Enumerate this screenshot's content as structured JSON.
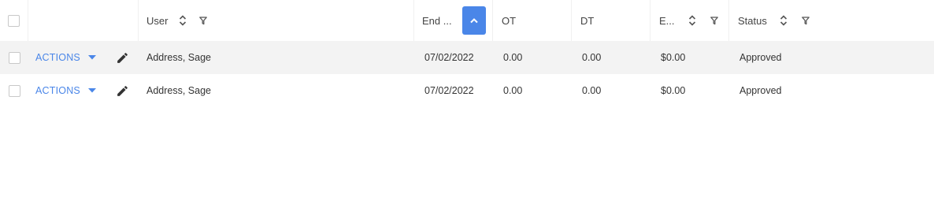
{
  "colors": {
    "accent": "#4a86e8",
    "row_shade": "#f3f3f3",
    "text": "#333333"
  },
  "header": {
    "user_label": "User",
    "end_label": "End ...",
    "ot_label": "OT",
    "dt_label": "DT",
    "e_label": "E...",
    "status_label": "Status",
    "end_sort_direction": "ascending"
  },
  "rows": [
    {
      "actions_label": "ACTIONS",
      "user": "Address, Sage",
      "end": "07/02/2022",
      "ot": "0.00",
      "dt": "0.00",
      "e": "$0.00",
      "status": "Approved"
    },
    {
      "actions_label": "ACTIONS",
      "user": "Address, Sage",
      "end": "07/02/2022",
      "ot": "0.00",
      "dt": "0.00",
      "e": "$0.00",
      "status": "Approved"
    }
  ],
  "icons": {
    "sort": "sort-icon",
    "filter": "filter-icon",
    "edit": "pencil-icon",
    "dropdown": "caret-down-icon",
    "active_sort": "chevron-up-icon"
  }
}
